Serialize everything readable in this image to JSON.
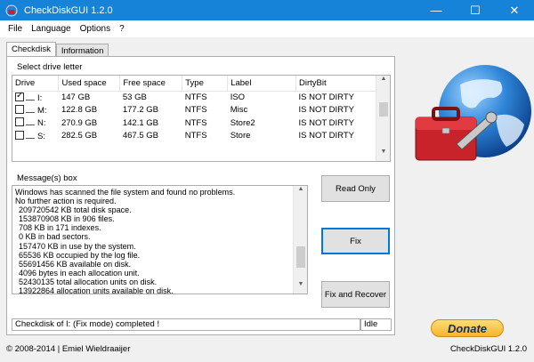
{
  "window": {
    "title": "CheckDiskGUI 1.2.0"
  },
  "menu": [
    "File",
    "Language",
    "Options",
    "?"
  ],
  "tabs": [
    "Checkdisk",
    "Information"
  ],
  "drives": {
    "group_label": "Select drive letter",
    "columns": [
      "Drive",
      "Used space",
      "Free space",
      "Type",
      "Label",
      "DirtyBit"
    ],
    "rows": [
      {
        "checked": true,
        "drive": "I:",
        "used": "147 GB",
        "free": "53 GB",
        "type": "NTFS",
        "label": "ISO",
        "dirty": "IS NOT DIRTY"
      },
      {
        "checked": false,
        "drive": "M:",
        "used": "122.8 GB",
        "free": "177.2 GB",
        "type": "NTFS",
        "label": "Misc",
        "dirty": "IS NOT DIRTY"
      },
      {
        "checked": false,
        "drive": "N:",
        "used": "270.9 GB",
        "free": "142.1 GB",
        "type": "NTFS",
        "label": "Store2",
        "dirty": "IS NOT DIRTY"
      },
      {
        "checked": false,
        "drive": "S:",
        "used": "282.5 GB",
        "free": "467.5 GB",
        "type": "NTFS",
        "label": "Store",
        "dirty": "IS NOT DIRTY"
      }
    ]
  },
  "messages": {
    "group_label": "Message(s) box",
    "lines": [
      "Windows has scanned the file system and found no problems.",
      "No further action is required.",
      "  209720542 KB total disk space.",
      "  153870908 KB in 906 files.",
      "  708 KB in 171 indexes.",
      "  0 KB in bad sectors.",
      "  157470 KB in use by the system.",
      "  65536 KB occupied by the log file.",
      "  55691456 KB available on disk.",
      "  4096 bytes in each allocation unit.",
      "  52430135 total allocation units on disk.",
      "  13922864 allocation units available on disk."
    ]
  },
  "buttons": {
    "read_only": "Read Only",
    "fix": "Fix",
    "fix_recover": "Fix and Recover",
    "donate": "Donate"
  },
  "status": {
    "main": "Checkdisk of I: (Fix mode) completed !",
    "state": "Idle"
  },
  "footer": {
    "copyright": "© 2008-2014 | Emiel Wieldraaijer",
    "version": "CheckDiskGUI 1.2.0"
  },
  "colors": {
    "titlebar": "#1683d8",
    "accent": "#0078d7",
    "toolbox": "#c8232b"
  }
}
